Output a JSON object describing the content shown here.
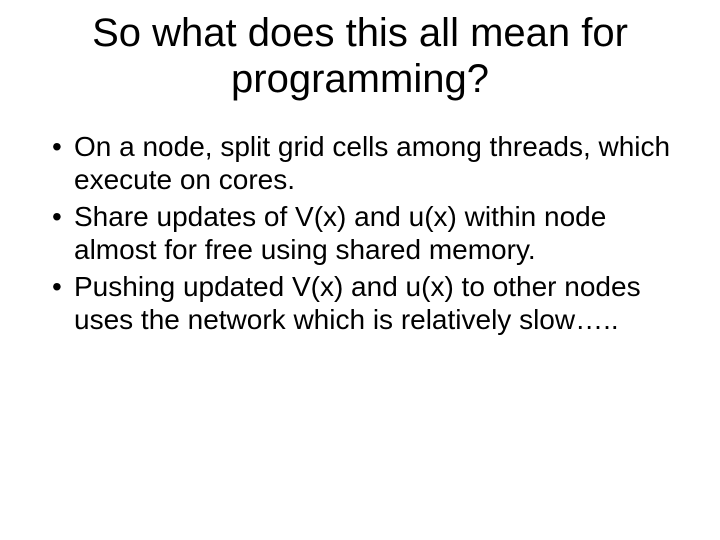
{
  "slide": {
    "title": "So what does this all mean for programming?",
    "bullets": [
      "On a node, split grid cells among threads, which execute on cores.",
      "Share updates of V(x) and u(x) within node almost for free using shared memory.",
      "Pushing updated V(x) and u(x) to other nodes uses the network which is relatively slow….."
    ]
  }
}
